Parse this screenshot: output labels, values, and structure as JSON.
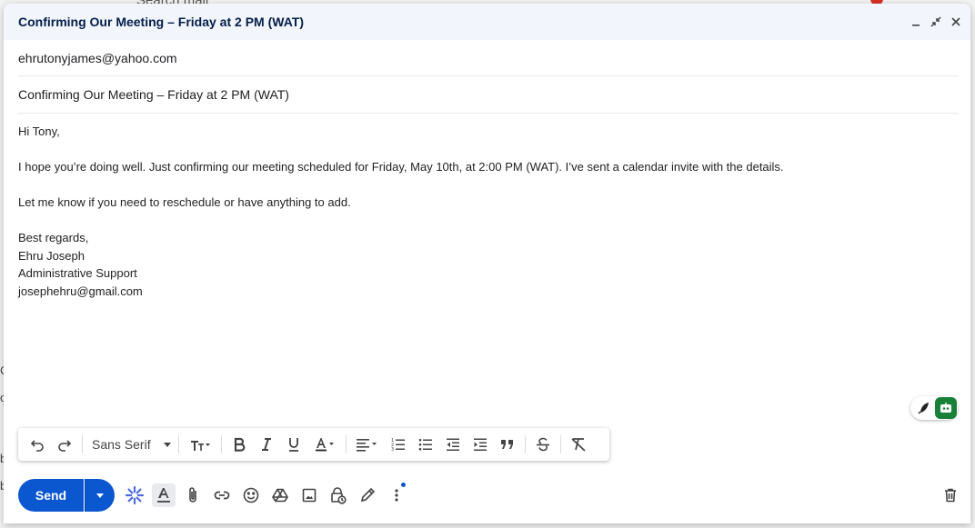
{
  "background": {
    "peek_text": "Search mail",
    "side_chars": [
      "C",
      "o",
      "b",
      "b"
    ]
  },
  "compose": {
    "title": "Confirming Our Meeting – Friday at 2 PM (WAT)",
    "to": "ehrutonyjames@yahoo.com",
    "subject": "Confirming Our Meeting – Friday at 2 PM (WAT)",
    "body": {
      "greeting": "Hi Tony,",
      "para1": "I hope you’re doing well. Just confirming our meeting scheduled for Friday, May 10th, at 2:00 PM (WAT). I’ve sent a calendar invite with the details.",
      "para2": "Let me know if you need to reschedule or have anything to add.",
      "closing": "Best regards,",
      "sig_name": "Ehru Joseph",
      "sig_title": "Administrative Support",
      "sig_email": "josephehru@gmail.com"
    }
  },
  "toolbar": {
    "font_name": "Sans Serif",
    "icons": [
      "undo-icon",
      "redo-icon",
      "text-size-icon",
      "bold-icon",
      "italic-icon",
      "underline-icon",
      "text-color-icon",
      "align-icon",
      "numbered-list-icon",
      "bulleted-list-icon",
      "indent-less-icon",
      "indent-more-icon",
      "quote-icon",
      "strikethrough-icon",
      "remove-formatting-icon"
    ]
  },
  "bottom": {
    "send_label": "Send",
    "icons": [
      "gemini-icon",
      "formatting-options-icon",
      "attach-icon",
      "link-icon",
      "emoji-icon",
      "drive-icon",
      "photo-icon",
      "confidential-icon",
      "signature-icon",
      "more-options-icon",
      "trash-icon"
    ]
  },
  "colors": {
    "accent": "#0b57d0",
    "title_bg": "#f2f6fc",
    "assist_green": "#188038"
  }
}
